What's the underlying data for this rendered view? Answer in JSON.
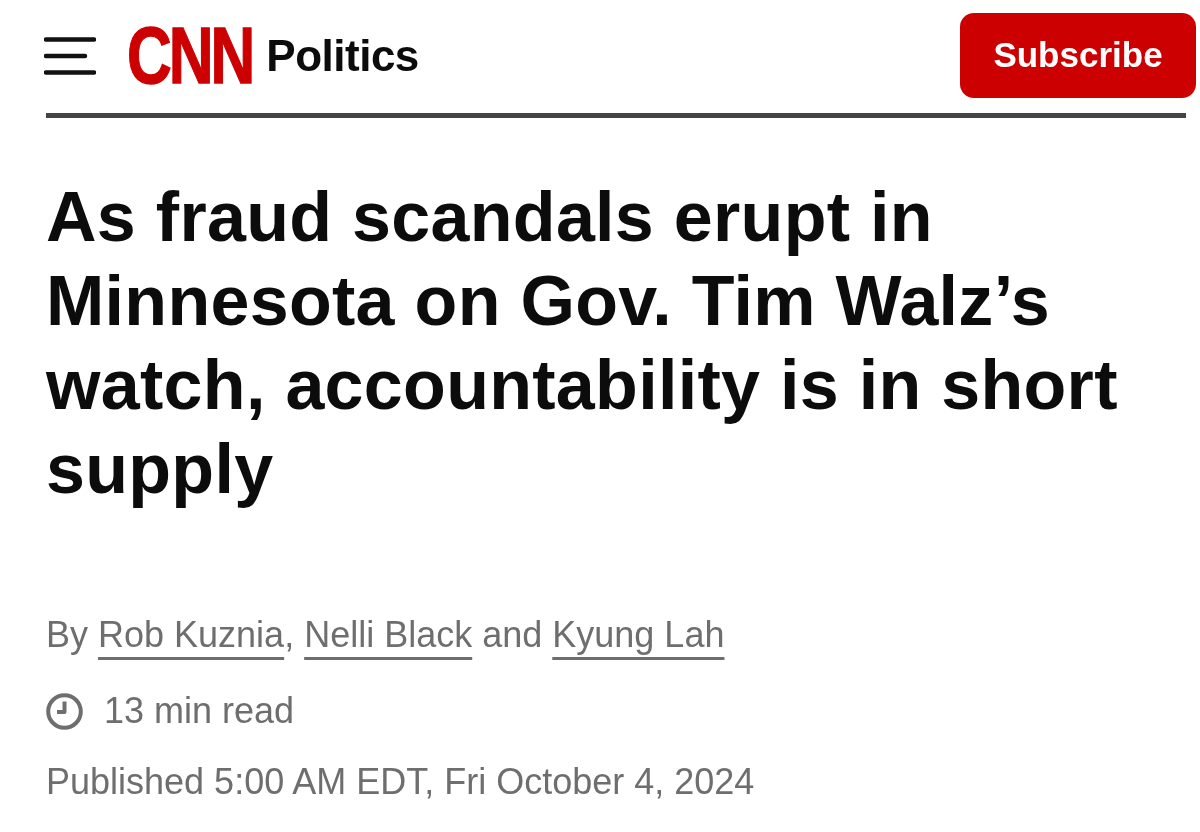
{
  "header": {
    "logo": "CNN",
    "section": "Politics",
    "subscribe_button": "Subscribe"
  },
  "article": {
    "headline": "As fraud scandals erupt in Minnesota on Gov. Tim Walz’s watch, accountability is in short supply",
    "byline": [
      {
        "kind": "text",
        "text": "By "
      },
      {
        "kind": "link",
        "text": "Rob Kuznia"
      },
      {
        "kind": "text",
        "text": ", "
      },
      {
        "kind": "link",
        "text": "Nelli Black"
      },
      {
        "kind": "text",
        "text": " and "
      },
      {
        "kind": "link",
        "text": "Kyung Lah"
      }
    ],
    "read_time": "13 min read",
    "published": "Published 5:00 AM EDT, Fri October 4, 2024"
  }
}
